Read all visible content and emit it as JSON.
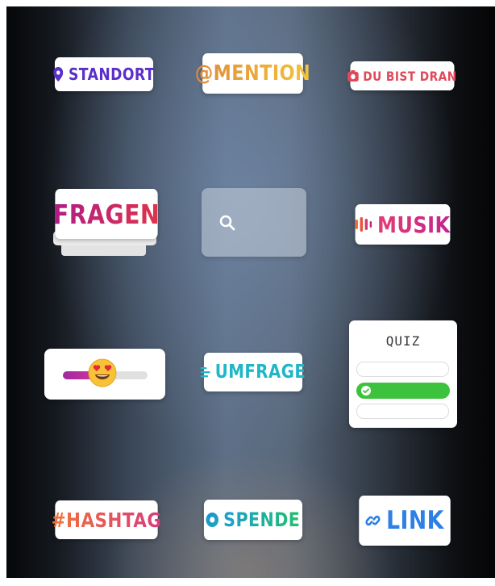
{
  "stickers": {
    "location": {
      "label": "STANDORT",
      "icon": "location-pin-icon",
      "color": "#5b2fc9"
    },
    "mention": {
      "label": "@MENTION",
      "colors": [
        "#e08a3a",
        "#f4c43a"
      ]
    },
    "your_turn": {
      "label": "DU BIST DRAN",
      "icon": "camera-icon",
      "color": "#e0495a"
    },
    "questions": {
      "label": "FRAGEN",
      "colors": [
        "#b01c86",
        "#e0344a"
      ]
    },
    "search": {
      "icon": "search-icon"
    },
    "music": {
      "label": "MUSIK",
      "icon": "sound-bars-icon",
      "colors": [
        "#f07033",
        "#c2238f"
      ]
    },
    "emoji_slider": {
      "icon": "heart-eyes-emoji-icon",
      "level": 0.45,
      "colors": [
        "#c52c95",
        "#e0e0e0"
      ]
    },
    "poll": {
      "label": "UMFRAGE",
      "icon": "poll-lines-icon",
      "color": "#1fb7c7"
    },
    "quiz": {
      "label": "QUIZ",
      "options_count": 3,
      "correct_index": 1,
      "correct_color": "#3cc23c"
    },
    "hashtag": {
      "label": "#HASHTAG",
      "colors": [
        "#f0753a",
        "#d83b7c"
      ]
    },
    "donation": {
      "label": "SPENDE",
      "icon": "donation-icon",
      "colors": [
        "#1a8fd6",
        "#22c06c"
      ]
    },
    "link": {
      "label": "LINK",
      "icon": "link-icon",
      "color": "#2c80e6"
    }
  }
}
